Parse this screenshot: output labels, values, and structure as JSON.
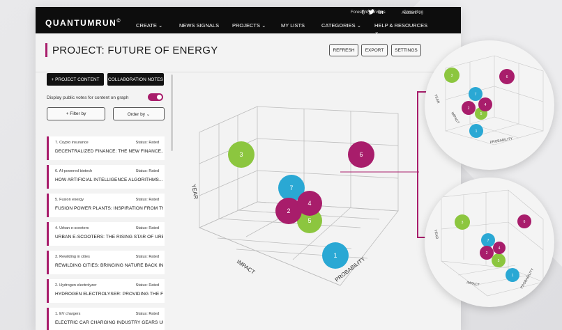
{
  "brand": {
    "name": "QUANTUMRUN",
    "mark": "©"
  },
  "util_links": [
    "Foresight Services",
    "Consulting"
  ],
  "social": [
    "f",
    "🐦",
    "in"
  ],
  "account": "Account ⌄",
  "nav": [
    "CREATE ⌄",
    "NEWS SIGNALS",
    "PROJECTS ⌄",
    "MY LISTS",
    "CATEGORIES ⌄",
    "HELP & RESOURCES ⌄"
  ],
  "page_title": "PROJECT: FUTURE OF ENERGY",
  "toolbar": {
    "refresh": "REFRESH",
    "export": "EXPORT",
    "settings": "SETTINGS"
  },
  "sidebar": {
    "project_content": "+ PROJECT CONTENT",
    "collab_notes": "COLLABORATION NOTES",
    "toggle_label": "Display public votes for content on graph",
    "filter": "+ Filter by",
    "order": "Order by ⌄",
    "cards": [
      {
        "cat": "7. Crypto insurance",
        "status": "Status: Rated",
        "title": "DECENTRALIZED FINANCE: THE NEW FINANCE..."
      },
      {
        "cat": "6. AI-powered biotech",
        "status": "Status: Rated",
        "title": "HOW ARTIFICIAL INTELLIGENCE ALGORITHMS..."
      },
      {
        "cat": "5. Fusion energy",
        "status": "Status: Rated",
        "title": "FUSION POWER PLANTS: INSPIRATION FROM THE..."
      },
      {
        "cat": "4. Urban e-scooters",
        "status": "Status: Rated",
        "title": "URBAN E-SCOOTERS: THE RISING STAR OF URBAN..."
      },
      {
        "cat": "3. Rewilding in cities",
        "status": "Status: Rated",
        "title": "REWILDING CITIES: BRINGING NATURE BACK INTO..."
      },
      {
        "cat": "2. Hydrogen electrolyzer",
        "status": "Status: Rated",
        "title": "HYDROGEN ELECTROLYSER: PROVIDING THE FUEL..."
      },
      {
        "cat": "1. EV chargers",
        "status": "Status: Rated",
        "title": "ELECTRIC CAR CHARGING INDUSTRY GEARS UP..."
      }
    ]
  },
  "chart": {
    "axis_labels": {
      "year": "YEAR",
      "impact": "IMPACT",
      "probability": "PROBABILITY"
    },
    "bubbles": [
      {
        "label": "3",
        "color": "#8cc63f"
      },
      {
        "label": "6",
        "color": "#a81d6b"
      },
      {
        "label": "7",
        "color": "#2aa8d4"
      },
      {
        "label": "4",
        "color": "#a81d6b"
      },
      {
        "label": "2",
        "color": "#a81d6b"
      },
      {
        "label": "5",
        "color": "#8cc63f"
      },
      {
        "label": "1",
        "color": "#2aa8d4"
      }
    ]
  },
  "inset_top": {
    "axis_labels": {
      "year": "YEAR",
      "impact": "IMPACT",
      "probability": "PROBABILITY"
    },
    "bubbles": [
      "3",
      "6",
      "7",
      "2",
      "4",
      "5",
      "1"
    ]
  },
  "inset_bottom": {
    "axis_labels": {
      "year": "YEAR",
      "impact": "IMPACT",
      "probability": "PROBABILITY"
    },
    "bubbles": [
      "3",
      "6",
      "7",
      "4",
      "2",
      "5",
      "1"
    ]
  },
  "colors": {
    "accent": "#a81d6b",
    "green": "#8cc63f",
    "blue": "#2aa8d4",
    "dark": "#0d0d0d"
  }
}
